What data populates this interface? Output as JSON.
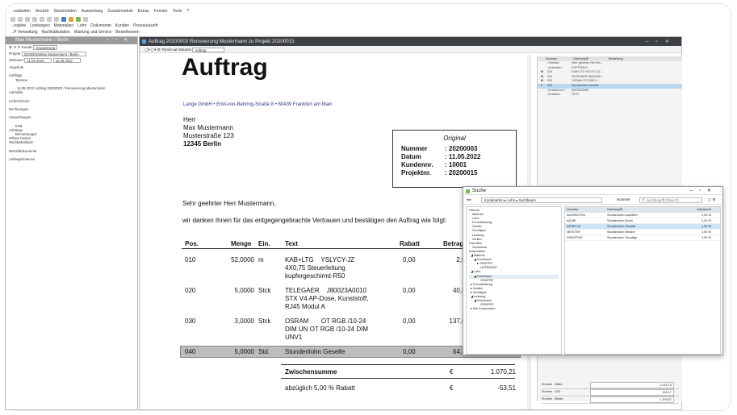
{
  "menu": [
    "...earbeiten",
    "Ansicht",
    "Stammdaten",
    "Auswertung",
    "Zusatzmodule",
    "Extras",
    "Fenster",
    "Tools",
    "?"
  ],
  "menu2": [
    "...rojekte",
    "Leistungen",
    "Materialien",
    "Lohn",
    "Dokumente",
    "Kunden",
    "Preisauskunft"
  ],
  "menu3": [
    "...P Verwaltung",
    "Nachkalkulation",
    "Wartung und Service",
    "Bestellwesen"
  ],
  "left_panel": {
    "title": "Max Mustermann / Berlin",
    "filter_label": "Kunde",
    "filter_value": "Gruppierung",
    "project_label": "Projekt",
    "project_value": "20200015/Max Mustermann / Berlin",
    "period_label": "Zeitraum",
    "date_from": "11.05.2022",
    "date_to": "11.05.2022",
    "tree": [
      "Angebote",
      "",
      "Aufträge",
      "Termine",
      "",
      "11.05.2022 Auftrag 20200003 / Renovierung Mustermann",
      "Aufmaße",
      "",
      "Lieferscheine",
      "",
      "Rechnungen",
      "",
      "Auswertungen",
      "",
      "EFB",
      "Anhänge",
      "Bemerkungen",
      "Offene Posten",
      "Nachkalkulation",
      "",
      "Bestelldokumente",
      "",
      "Auftragschancen"
    ]
  },
  "doc_window": {
    "title": "Auftrag 20200003 Renovierung Mustermann zu Projekt 20200015",
    "tool_termin": "Termin",
    "tool_variante": "Variante",
    "variante_value": "Auftrag"
  },
  "document": {
    "heading": "Auftrag",
    "sender": "Lange GmbH • Emil-von-Behring-Straße 8 • 60439 Frankfurt am Main",
    "address": [
      "Herr",
      "Max Mustermann",
      "Musterstraße 123",
      "12345 Berlin"
    ],
    "infobox": {
      "header": "Original",
      "rows": [
        {
          "label": "Nummer",
          "value": ": 20200003"
        },
        {
          "label": "Datum",
          "value": ": 11.05.2022"
        },
        {
          "label": "Kundennr.",
          "value": ": 10001"
        },
        {
          "label": "Projektnr.",
          "value": ": 20200015"
        }
      ]
    },
    "salutation": "Sehr geehrter Herr Mustermann,",
    "intro": "wir danken Ihnen für das entgegengebrachte Vertrauen und bestätigen den Auftrag wie folgt:",
    "columns": {
      "pos": "Pos.",
      "menge": "Menge",
      "ein": "Ein.",
      "text": "Text",
      "rabatt": "Rabatt",
      "betrag": "Betrag"
    },
    "items": [
      {
        "pos": "010",
        "menge": "52,0000",
        "ein": "m",
        "text": [
          "KAB+LTG    YSLYCY-JZ",
          "4X0,75 Steuerleitung",
          "kupfergeschirmt-R50"
        ],
        "rabatt": "0,00",
        "betrag": "2,52"
      },
      {
        "pos": "020",
        "menge": "5,0000",
        "ein": "Stck",
        "text": [
          "TELEGAER    J80023A0010",
          "STX V4 AP-Dose, Kunststoff,",
          "RJ45 Modul A"
        ],
        "rabatt": "0,00",
        "betrag": "40,87"
      },
      {
        "pos": "030",
        "menge": "3,0000",
        "ein": "Stck",
        "text": [
          "OSRAM       OT RGB /10-24",
          "DIM UN OT RGB /10-24 DIM",
          "UNV1"
        ],
        "rabatt": "0,00",
        "betrag": "137,69"
      },
      {
        "pos": "040",
        "menge": "5,0000",
        "ein": "Std.",
        "text": [
          "Stundenlohn Geselle"
        ],
        "rabatt": "0,00",
        "betrag": "64,35"
      }
    ],
    "zwischensumme_label": "Zwischensumme",
    "zwischensumme_cur": "€",
    "zwischensumme_value": "1.070,21",
    "rabatt_label": "abzüglich 5,00 % Rabatt",
    "rabatt_cur": "€",
    "rabatt_value": "-53,51"
  },
  "right_pane": {
    "headers": [
      "Nummer",
      "Oberbegriff",
      "Bestellung"
    ],
    "rows": [
      {
        "k": "",
        "n": "<Vortext>",
        "t": "Sehr geehrter Herr Mu..."
      },
      {
        "k": "",
        "n": "<Aufmaße>",
        "t": "KOPFZEILE"
      },
      {
        "k": "M",
        "n": "010",
        "t": "KAB+LTG  YSLYCY-JZ..."
      },
      {
        "k": "M",
        "n": "020",
        "t": "TELEGAER  J80023A0..."
      },
      {
        "k": "M",
        "n": "030",
        "t": "OSRAM   OT RGB /1..."
      },
      {
        "k": "L",
        "n": "040",
        "t": "Stundenlohn Geselle"
      },
      {
        "k": "",
        "n": "<Endsumme>",
        "t": "ENDSUMME"
      },
      {
        "k": "",
        "n": "<Endtext>",
        "t": "TEXT"
      }
    ],
    "sums": [
      {
        "label": "Summe - Netto",
        "value": "1.016,70"
      },
      {
        "label": "Summe - USt",
        "value": "193,17"
      },
      {
        "label": "Summe - Brutto",
        "value": "1.209,87"
      }
    ]
  },
  "suche": {
    "title": "Suche",
    "breadcrumb": "Kostenarten  ▸ Lohn  ▸ Suchbaum",
    "search_label": "Nummer",
    "search_placeholder": "Suchbegriff (Strg+F)",
    "tree": [
      "Historie",
      "Material",
      "Lohn",
      "Fremdleistung",
      "Geräte",
      "Sonstiges",
      "Leistung",
      "Vorlieb",
      "Favoriten",
      "Suchbaum",
      "Kostenarten",
      "◢ Material",
      "◢ Suchbaum",
      "▸ GRUPPE",
      "LIEFERANT",
      "◢ Lohn",
      "◢ Suchbaum",
      "GRUPPE",
      "▸ Fremdleistung",
      "▸ Geräte",
      "▸ Sonstiges",
      "◢ Leistung",
      "◢ Suchbaum",
      "GRUPPE",
      "▸ Alle Kostenarten"
    ],
    "columns": [
      "Nummer",
      "Oberbegriff",
      "Arbeitszeit"
    ],
    "rows": [
      {
        "n": "AUSHELFEN",
        "o": "Stundenlohn Aushilfen",
        "a": "1,00 St"
      },
      {
        "n": "AZUBI",
        "o": "Stundenlohn Azubi",
        "a": "1,00 St"
      },
      {
        "n": "GESELLE",
        "o": "Stundenlohn Geselle",
        "a": "1,00 St"
      },
      {
        "n": "MEISTER",
        "o": "Stundenlohn Meister",
        "a": "1,00 St"
      },
      {
        "n": "SONSTIGE",
        "o": "Stundenlohn Sonstige",
        "a": "1,00 St"
      }
    ]
  }
}
